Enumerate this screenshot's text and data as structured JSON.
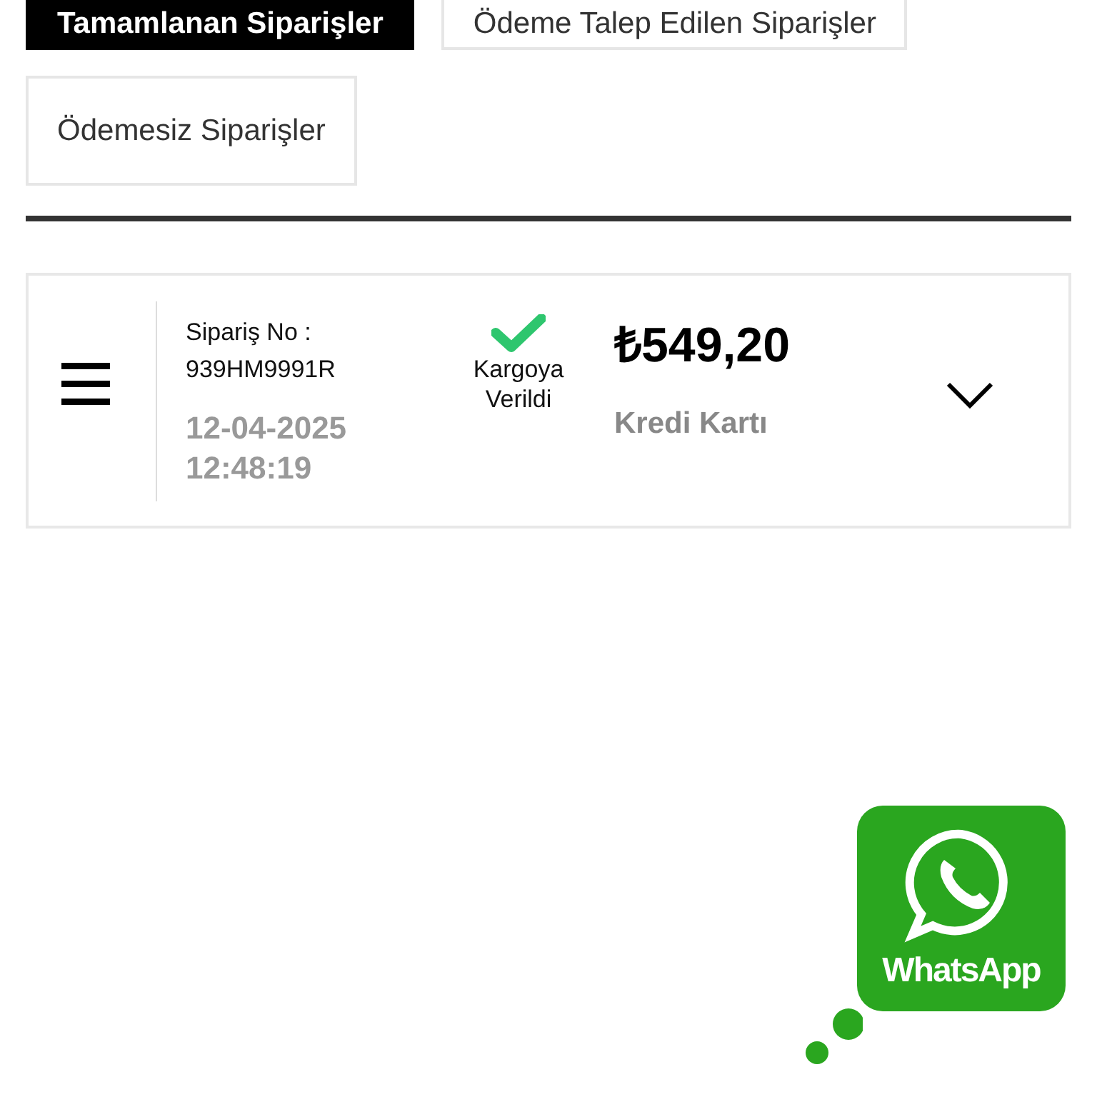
{
  "tabs": [
    {
      "label": "Tamamlanan Siparişler",
      "selected": true
    },
    {
      "label": "Ödeme Talep Edilen Siparişler",
      "selected": false
    },
    {
      "label": "Ödemesiz Siparişler",
      "selected": false
    }
  ],
  "orders": [
    {
      "order_no_label": "Sipariş No :",
      "order_no": "939HM9991R",
      "date": "12-04-2025",
      "time": "12:48:19",
      "status": "Kargoya Verildi",
      "shipped": true,
      "amount": "₺549,20",
      "payment": "Kredi Kartı",
      "expanded": false
    }
  ],
  "whatsapp": {
    "label": "WhatsApp"
  }
}
